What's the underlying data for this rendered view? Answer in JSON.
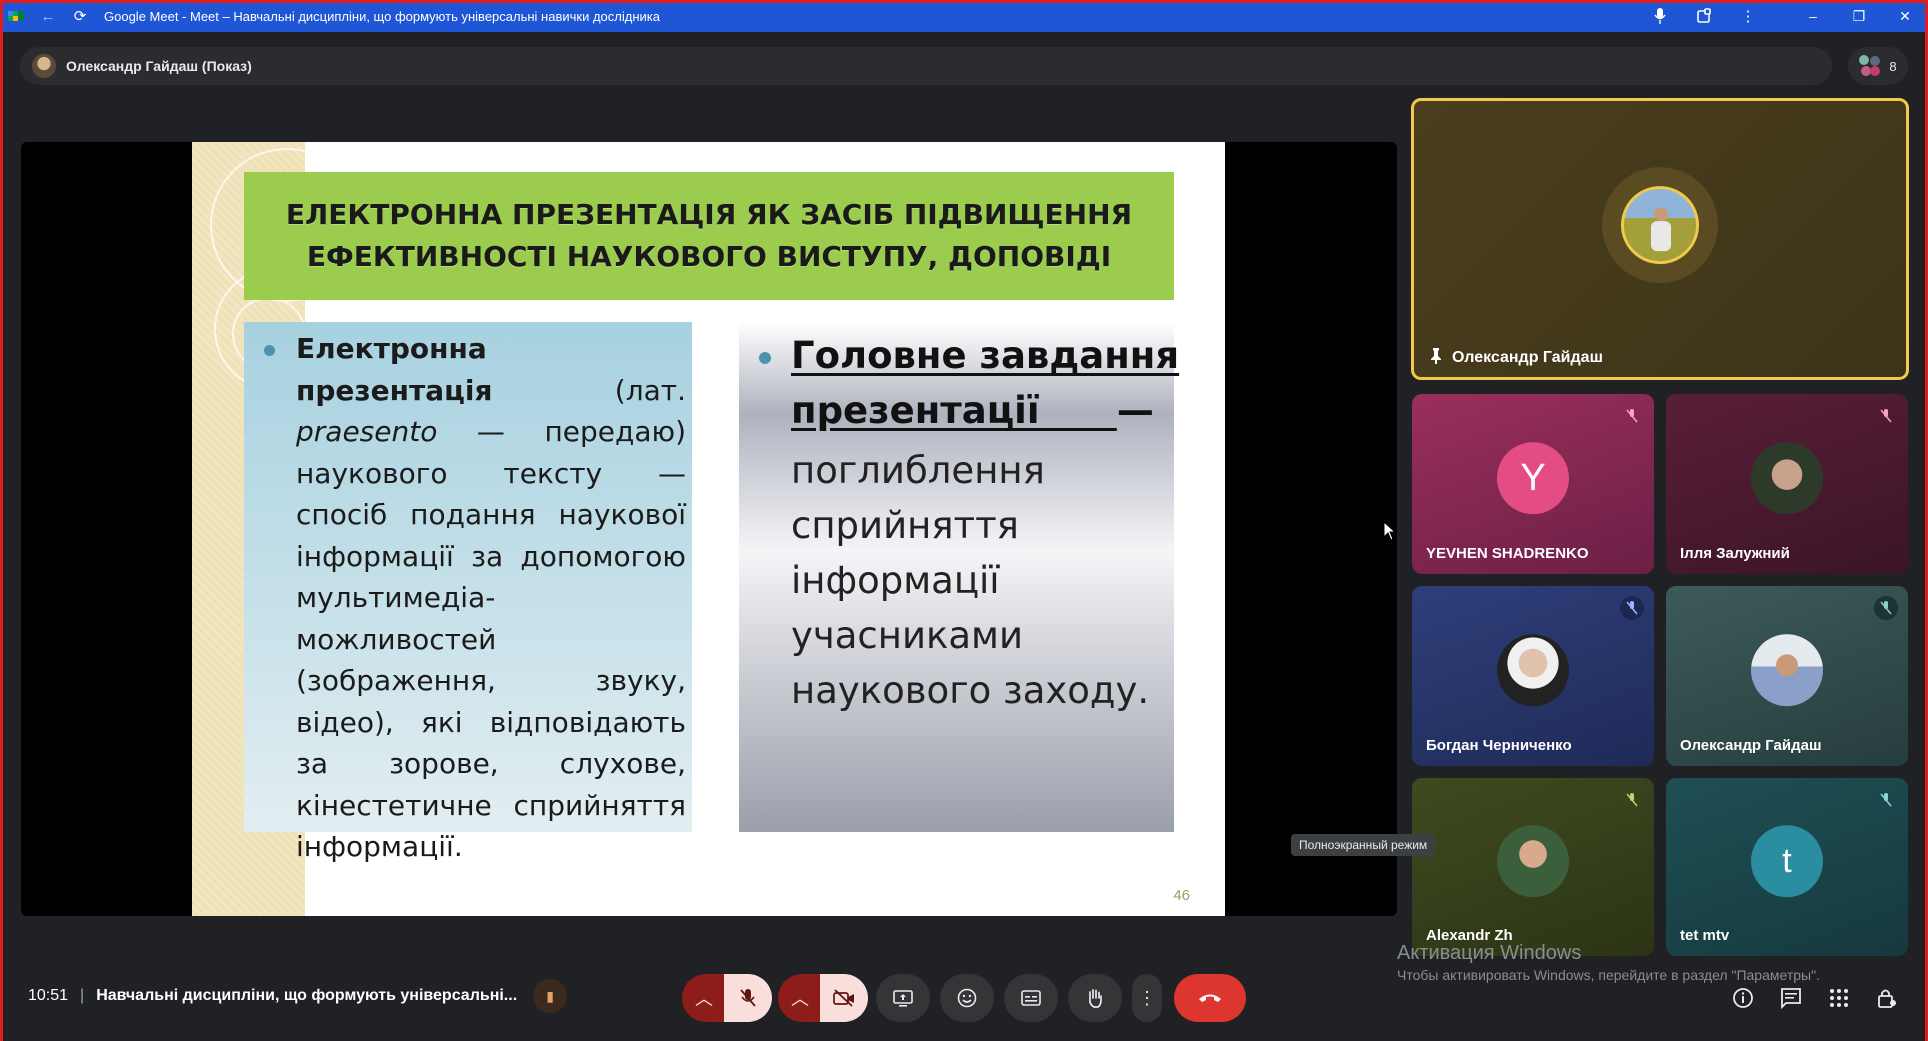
{
  "browser": {
    "tab_title": "Google Meet - Meet – Навчальні дисципліни, що формують універсальні навички дослідника"
  },
  "presenter_bar": {
    "label": "Олександр Гайдаш (Показ)"
  },
  "people": {
    "count": "8"
  },
  "slide": {
    "title": "ЕЛЕКТРОННА ПРЕЗЕНТАЦІЯ ЯК ЗАСІБ ПІДВИЩЕННЯ ЕФЕКТИВНОСТІ НАУКОВОГО ВИСТУПУ, ДОПОВІДІ",
    "left_bold": "Електронна презентація",
    "left_text_a": "(лат. ",
    "left_italic": "praesento",
    "left_text_b": " — передаю) наукового тексту — спосіб подання наукової інформації за допомогою мультимедіа-можливостей (зображення, звуку, відео), які відповідають за зорове, слухове, кінестетичне сприйняття інформації.",
    "right_head": "Головне завдання презентації",
    "right_dash": "—",
    "right_body": "поглиблення сприйняття інформації учасниками наукового заходу.",
    "page_number": "46"
  },
  "tiles": {
    "pinned": {
      "name": "Олександр Гайдаш"
    },
    "t1": {
      "initial": "Y",
      "name": "YEVHEN SHADRENKO"
    },
    "t2": {
      "name": "Ілля Залужний"
    },
    "t3": {
      "name": "Богдан Черниченко"
    },
    "t4": {
      "name": "Олександр Гайдаш"
    },
    "t5": {
      "name": "Alexandr Zh"
    },
    "t6": {
      "initial": "t",
      "name": "tet mtv"
    }
  },
  "tooltip": "Полноэкранный режим",
  "activation": {
    "title": "Активация Windows",
    "subtitle": "Чтобы активировать Windows, перейдите в раздел \"Параметры\"."
  },
  "bottom": {
    "time": "10:51",
    "separator": "|",
    "meeting_name": "Навчальні дисципліни, що формують універсальні..."
  },
  "colors": {
    "title_bar": "#1f56d6",
    "slide_title_bg": "#9ccc4e",
    "end_call": "#dc362e",
    "mic_off_bg": "#f9dedc",
    "pinned_border": "#f2c94c"
  }
}
